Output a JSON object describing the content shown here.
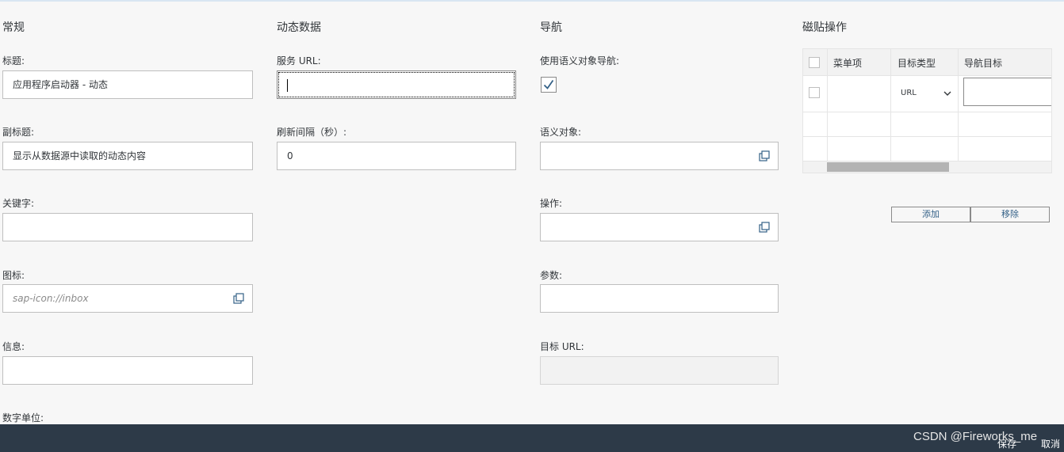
{
  "sections": {
    "general": "常规",
    "dynamic": "动态数据",
    "navigation": "导航",
    "tile_actions": "磁贴操作"
  },
  "general": {
    "title_label": "标题:",
    "title_value": "应用程序启动器 - 动态",
    "subtitle_label": "副标题:",
    "subtitle_value": "显示从数据源中读取的动态内容",
    "keywords_label": "关键字:",
    "keywords_value": "",
    "icon_label": "图标:",
    "icon_placeholder": "sap-icon://inbox",
    "info_label": "信息:",
    "info_value": "",
    "number_unit_label": "数字单位:"
  },
  "dynamic": {
    "service_url_label": "服务 URL:",
    "service_url_value": "",
    "refresh_label": "刷新间隔（秒）:",
    "refresh_value": "0"
  },
  "navigation": {
    "use_semantic_label": "使用语义对象导航:",
    "use_semantic_checked": true,
    "semantic_object_label": "语义对象:",
    "semantic_object_value": "",
    "action_label": "操作:",
    "action_value": "",
    "params_label": "参数:",
    "params_value": "",
    "target_url_label": "目标 URL:",
    "target_url_value": ""
  },
  "tile_actions": {
    "columns": [
      "菜单项",
      "目标类型",
      "导航目标"
    ],
    "rows": [
      {
        "menu_item": "",
        "target_type": "URL",
        "nav_target": ""
      }
    ],
    "add_label": "添加",
    "remove_label": "移除"
  },
  "footer": {
    "save_label": "保存",
    "cancel_label": "取消"
  },
  "watermark": "CSDN @Fireworks_me",
  "colors": {
    "accent": "#346187",
    "footer_bg": "#2d3a48",
    "check": "#346187"
  }
}
